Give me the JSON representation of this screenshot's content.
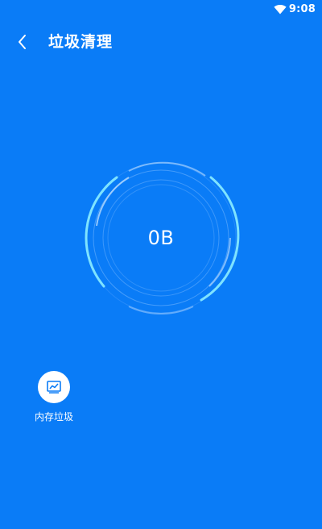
{
  "status_bar": {
    "time": "9:08",
    "icons": [
      "wifi-icon"
    ]
  },
  "header": {
    "back_icon": "chevron-left-icon",
    "title": "垃圾清理"
  },
  "scan": {
    "size": "0B"
  },
  "categories": [
    {
      "label": "内存垃圾",
      "icon": "memory-chart-icon"
    }
  ],
  "colors": {
    "background": "#0a7cf7",
    "ring_accent": "#7ee3ff",
    "ring_faint": "#6fb2ff",
    "icon_blue": "#0a7cf7",
    "text": "#ffffff"
  }
}
